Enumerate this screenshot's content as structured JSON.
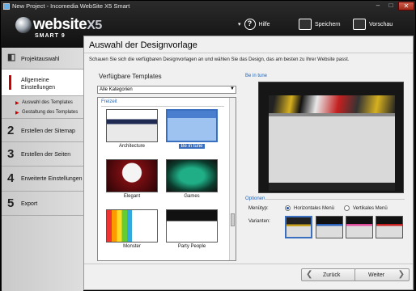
{
  "window": {
    "title": "New Project - Incomedia WebSite X5 Smart",
    "minimize": "–",
    "maximize": "□",
    "close": "✕"
  },
  "brand": {
    "name": "website",
    "version": "X5",
    "edition": "SMART 9"
  },
  "toolbar": {
    "help_label": "Hilfe",
    "help_icon": "?",
    "save_label": "Speichern",
    "preview_label": "Vorschau"
  },
  "sidebar": {
    "items": [
      {
        "num": "",
        "label": "Projektauswahl"
      },
      {
        "num": "",
        "label": "Allgemeine Einstellungen"
      },
      {
        "num": "2",
        "label": "Erstellen der Sitemap"
      },
      {
        "num": "3",
        "label": "Erstellen der Seiten"
      },
      {
        "num": "4",
        "label": "Erweiterte Einstellungen"
      },
      {
        "num": "5",
        "label": "Export"
      }
    ],
    "subitems": [
      "Auswahl des Templates",
      "Gestaltung des Templates"
    ]
  },
  "main": {
    "title": "Auswahl der Designvorlage",
    "description": "Schauen Sie sich die verfügbaren Designvorlagen an und wählen Sie das Design, das am besten zu Ihrer Website passt.",
    "templates_title": "Verfügbare Templates",
    "category_select": "Alle Kategorien",
    "group_label": "Freizeit",
    "templates": [
      "Architecture",
      "Be in tune",
      "Elegant",
      "Games",
      "Monster",
      "Party People"
    ],
    "selected_template": "Be in tune",
    "preview_title": "Be in tune",
    "options_title": "Optionen",
    "menu_type_label": "Menütyp:",
    "menu_horizontal": "Horizontales Menü",
    "menu_vertical": "Vertikales Menü",
    "menu_selected": "horizontal",
    "variants_label": "Varianten:",
    "back_button": "Zurück",
    "next_button": "Weiter"
  },
  "colors": {
    "accent": "#cc0000",
    "selection": "#3a6fc0",
    "link_blue": "#2266bb"
  }
}
